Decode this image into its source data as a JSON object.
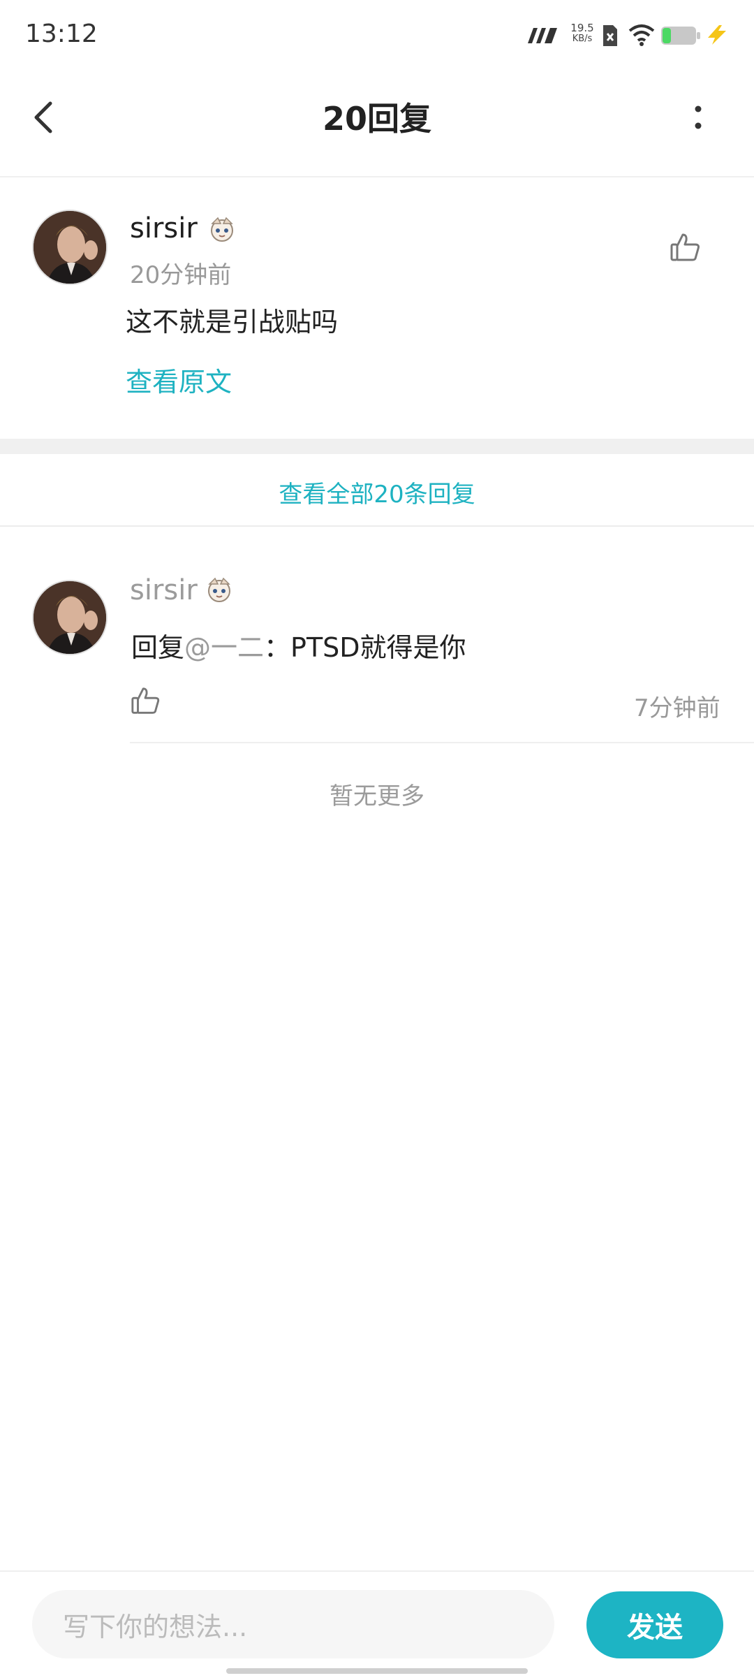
{
  "status_bar": {
    "time": "13:12",
    "net_speed_value": "19.5",
    "net_speed_unit": "KB/s",
    "icons": [
      "signal-icon",
      "sim-icon",
      "wifi-icon",
      "battery-icon",
      "charging-icon"
    ],
    "battery_color": "#4cd964",
    "charge_color": "#f5c518"
  },
  "header": {
    "title": "20回复",
    "back_icon": "chevron-left-icon",
    "more_icon": "more-vertical-icon"
  },
  "original_comment": {
    "username": "sirsir",
    "time": "20分钟前",
    "content": "这不就是引战贴吗",
    "view_original": "查看原文",
    "like_icon": "thumbs-up-icon"
  },
  "view_all_link": "查看全部20条回复",
  "replies": [
    {
      "username": "sirsir",
      "reply_prefix": "回复",
      "reply_target": "@一二",
      "reply_sep": "：",
      "content": "PTSD就得是你",
      "time": "7分钟前",
      "like_icon": "thumbs-up-icon"
    }
  ],
  "no_more_text": "暂无更多",
  "composer": {
    "placeholder": "写下你的想法...",
    "send_label": "发送"
  },
  "colors": {
    "accent": "#1eb2c1",
    "separator": "#f0f0f0"
  }
}
